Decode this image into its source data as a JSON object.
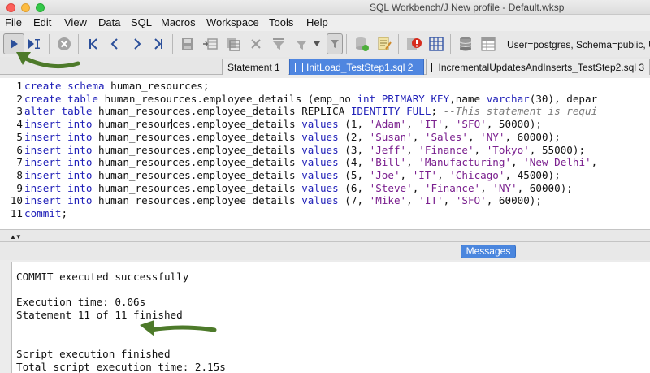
{
  "window": {
    "title": "SQL Workbench/J New profile - Default.wksp"
  },
  "menu": [
    "File",
    "Edit",
    "View",
    "Data",
    "SQL",
    "Macros",
    "Workspace",
    "Tools",
    "Help"
  ],
  "toolbar": {
    "connection_info": "User=postgres, Schema=public, U"
  },
  "tabs": [
    {
      "label": "Statement 1",
      "active": false
    },
    {
      "label": "InitLoad_TestStep1.sql 2",
      "active": true
    },
    {
      "label": "IncrementalUpdatesAndInserts_TestStep2.sql 3",
      "active": false
    }
  ],
  "editor": {
    "line_numbers": [
      "1",
      "2",
      "3",
      "4",
      "5",
      "6",
      "7",
      "8",
      "9",
      "10",
      "11"
    ],
    "lines": [
      [
        {
          "t": "kw",
          "v": "create schema"
        },
        {
          "t": "p",
          "v": " human_resources;"
        }
      ],
      [
        {
          "t": "kw",
          "v": "create table"
        },
        {
          "t": "p",
          "v": " human_resources.employee_details (emp_no "
        },
        {
          "t": "kw",
          "v": "int PRIMARY KEY"
        },
        {
          "t": "p",
          "v": ",name "
        },
        {
          "t": "kw",
          "v": "varchar"
        },
        {
          "t": "p",
          "v": "(30), depar"
        }
      ],
      [
        {
          "t": "kw",
          "v": "alter table"
        },
        {
          "t": "p",
          "v": " human_resources.employee_details REPLICA "
        },
        {
          "t": "kw",
          "v": "IDENTITY FULL"
        },
        {
          "t": "p",
          "v": "; "
        },
        {
          "t": "c",
          "v": "--This statement is requi"
        }
      ],
      [
        {
          "t": "kw",
          "v": "insert into"
        },
        {
          "t": "p",
          "v": " human_resour"
        },
        {
          "t": "caret",
          "v": ""
        },
        {
          "t": "p",
          "v": "ces.employee_details "
        },
        {
          "t": "kw",
          "v": "values"
        },
        {
          "t": "p",
          "v": " (1, "
        },
        {
          "t": "s",
          "v": "'Adam'"
        },
        {
          "t": "p",
          "v": ", "
        },
        {
          "t": "s",
          "v": "'IT'"
        },
        {
          "t": "p",
          "v": ", "
        },
        {
          "t": "s",
          "v": "'SFO'"
        },
        {
          "t": "p",
          "v": ", 50000);"
        }
      ],
      [
        {
          "t": "kw",
          "v": "insert into"
        },
        {
          "t": "p",
          "v": " human_resources.employee_details "
        },
        {
          "t": "kw",
          "v": "values"
        },
        {
          "t": "p",
          "v": " (2, "
        },
        {
          "t": "s",
          "v": "'Susan'"
        },
        {
          "t": "p",
          "v": ", "
        },
        {
          "t": "s",
          "v": "'Sales'"
        },
        {
          "t": "p",
          "v": ", "
        },
        {
          "t": "s",
          "v": "'NY'"
        },
        {
          "t": "p",
          "v": ", 60000);"
        }
      ],
      [
        {
          "t": "kw",
          "v": "insert into"
        },
        {
          "t": "p",
          "v": " human_resources.employee_details "
        },
        {
          "t": "kw",
          "v": "values"
        },
        {
          "t": "p",
          "v": " (3, "
        },
        {
          "t": "s",
          "v": "'Jeff'"
        },
        {
          "t": "p",
          "v": ", "
        },
        {
          "t": "s",
          "v": "'Finance'"
        },
        {
          "t": "p",
          "v": ", "
        },
        {
          "t": "s",
          "v": "'Tokyo'"
        },
        {
          "t": "p",
          "v": ", 55000);"
        }
      ],
      [
        {
          "t": "kw",
          "v": "insert into"
        },
        {
          "t": "p",
          "v": " human_resources.employee_details "
        },
        {
          "t": "kw",
          "v": "values"
        },
        {
          "t": "p",
          "v": " (4, "
        },
        {
          "t": "s",
          "v": "'Bill'"
        },
        {
          "t": "p",
          "v": ", "
        },
        {
          "t": "s",
          "v": "'Manufacturing'"
        },
        {
          "t": "p",
          "v": ", "
        },
        {
          "t": "s",
          "v": "'New Delhi'"
        },
        {
          "t": "p",
          "v": ","
        }
      ],
      [
        {
          "t": "kw",
          "v": "insert into"
        },
        {
          "t": "p",
          "v": " human_resources.employee_details "
        },
        {
          "t": "kw",
          "v": "values"
        },
        {
          "t": "p",
          "v": " (5, "
        },
        {
          "t": "s",
          "v": "'Joe'"
        },
        {
          "t": "p",
          "v": ", "
        },
        {
          "t": "s",
          "v": "'IT'"
        },
        {
          "t": "p",
          "v": ", "
        },
        {
          "t": "s",
          "v": "'Chicago'"
        },
        {
          "t": "p",
          "v": ", 45000);"
        }
      ],
      [
        {
          "t": "kw",
          "v": "insert into"
        },
        {
          "t": "p",
          "v": " human_resources.employee_details "
        },
        {
          "t": "kw",
          "v": "values"
        },
        {
          "t": "p",
          "v": " (6, "
        },
        {
          "t": "s",
          "v": "'Steve'"
        },
        {
          "t": "p",
          "v": ", "
        },
        {
          "t": "s",
          "v": "'Finance'"
        },
        {
          "t": "p",
          "v": ", "
        },
        {
          "t": "s",
          "v": "'NY'"
        },
        {
          "t": "p",
          "v": ", 60000);"
        }
      ],
      [
        {
          "t": "kw",
          "v": "insert into"
        },
        {
          "t": "p",
          "v": " human_resources.employee_details "
        },
        {
          "t": "kw",
          "v": "values"
        },
        {
          "t": "p",
          "v": " (7, "
        },
        {
          "t": "s",
          "v": "'Mike'"
        },
        {
          "t": "p",
          "v": ", "
        },
        {
          "t": "s",
          "v": "'IT'"
        },
        {
          "t": "p",
          "v": ", "
        },
        {
          "t": "s",
          "v": "'SFO'"
        },
        {
          "t": "p",
          "v": ", 60000);"
        }
      ],
      [
        {
          "t": "kw",
          "v": "commit"
        },
        {
          "t": "p",
          "v": ";"
        }
      ]
    ]
  },
  "results": {
    "tab_label": "Messages",
    "messages": [
      "COMMIT executed successfully",
      "",
      "Execution time: 0.06s",
      "Statement 11 of 11 finished",
      "",
      "",
      "Script execution finished",
      "Total script execution time: 2.15s"
    ]
  },
  "colors": {
    "keyword": "#1f1fb8",
    "string": "#7a1f8e",
    "comment": "#7a7a7a",
    "active_tab": "#4f86e0",
    "annotation_arrow": "#4d7a2a"
  },
  "icons": {
    "toolbar": [
      "run-icon",
      "run-current-icon",
      "stop-icon",
      "first-icon",
      "previous-icon",
      "next-icon",
      "last-icon",
      "save-icon",
      "insert-row-icon",
      "copy-row-icon",
      "delete-row-icon",
      "filter-icon",
      "filter-dropdown-icon",
      "db-explorer-icon",
      "edit-icon",
      "alert-icon",
      "grid-icon",
      "database-icon",
      "table-icon"
    ]
  }
}
